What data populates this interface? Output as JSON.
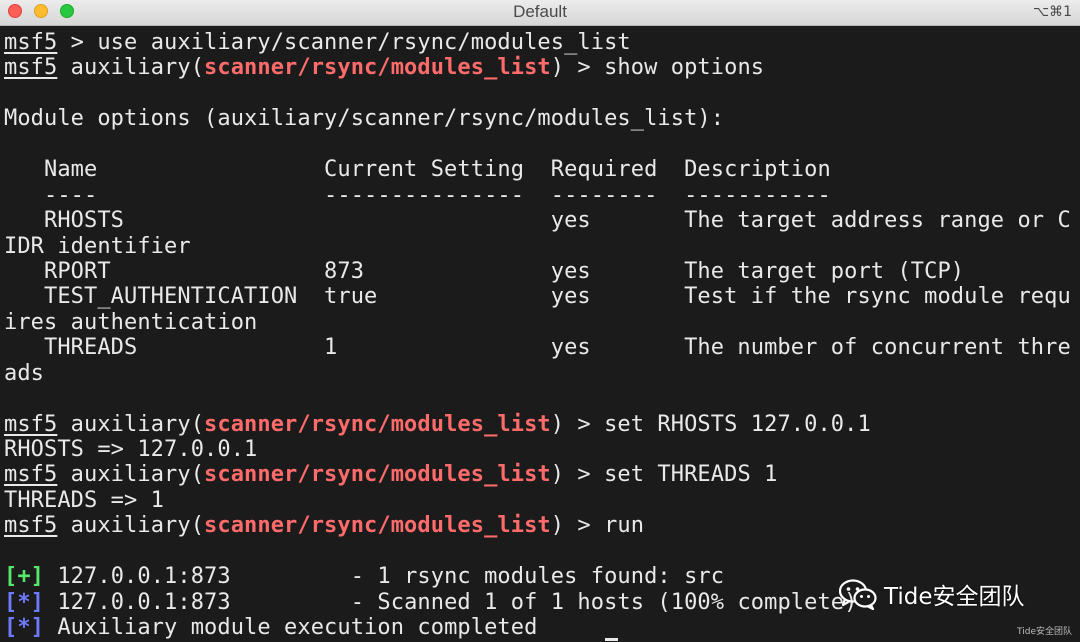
{
  "window": {
    "title": "Default",
    "shortcut": "⌥⌘1"
  },
  "terminal": {
    "lines": [
      {
        "parts": [
          {
            "t": "msf5",
            "cls": "u"
          },
          {
            "t": " > use auxiliary/scanner/rsync/modules_list"
          }
        ]
      },
      {
        "parts": [
          {
            "t": "msf5",
            "cls": "u"
          },
          {
            "t": " auxiliary("
          },
          {
            "t": "scanner/rsync/modules_list",
            "cls": "mod"
          },
          {
            "t": ") > show options"
          }
        ]
      },
      {
        "parts": [
          {
            "t": ""
          }
        ]
      },
      {
        "parts": [
          {
            "t": "Module options (auxiliary/scanner/rsync/modules_list):"
          }
        ]
      },
      {
        "parts": [
          {
            "t": ""
          }
        ]
      },
      {
        "parts": [
          {
            "t": "   Name                 Current Setting  Required  Description"
          }
        ]
      },
      {
        "parts": [
          {
            "t": "   ----                 ---------------  --------  -----------"
          }
        ]
      },
      {
        "parts": [
          {
            "t": "   RHOSTS                                yes       The target address range or C"
          }
        ]
      },
      {
        "parts": [
          {
            "t": "IDR identifier"
          }
        ]
      },
      {
        "parts": [
          {
            "t": "   RPORT                873              yes       The target port (TCP)"
          }
        ]
      },
      {
        "parts": [
          {
            "t": "   TEST_AUTHENTICATION  true             yes       Test if the rsync module requ"
          }
        ]
      },
      {
        "parts": [
          {
            "t": "ires authentication"
          }
        ]
      },
      {
        "parts": [
          {
            "t": "   THREADS              1                yes       The number of concurrent thre"
          }
        ]
      },
      {
        "parts": [
          {
            "t": "ads"
          }
        ]
      },
      {
        "parts": [
          {
            "t": ""
          }
        ]
      },
      {
        "parts": [
          {
            "t": "msf5",
            "cls": "u"
          },
          {
            "t": " auxiliary("
          },
          {
            "t": "scanner/rsync/modules_list",
            "cls": "mod"
          },
          {
            "t": ") > set RHOSTS 127.0.0.1"
          }
        ]
      },
      {
        "parts": [
          {
            "t": "RHOSTS => 127.0.0.1"
          }
        ]
      },
      {
        "parts": [
          {
            "t": "msf5",
            "cls": "u"
          },
          {
            "t": " auxiliary("
          },
          {
            "t": "scanner/rsync/modules_list",
            "cls": "mod"
          },
          {
            "t": ") > set THREADS 1"
          }
        ]
      },
      {
        "parts": [
          {
            "t": "THREADS => 1"
          }
        ]
      },
      {
        "parts": [
          {
            "t": "msf5",
            "cls": "u"
          },
          {
            "t": " auxiliary("
          },
          {
            "t": "scanner/rsync/modules_list",
            "cls": "mod"
          },
          {
            "t": ") > run"
          }
        ]
      },
      {
        "parts": [
          {
            "t": ""
          }
        ]
      },
      {
        "parts": [
          {
            "t": "[+]",
            "cls": "brk"
          },
          {
            "t": " 127.0.0.1:873         - 1 rsync modules found: src"
          }
        ]
      },
      {
        "parts": [
          {
            "t": "[*]",
            "cls": "brk-i"
          },
          {
            "t": " 127.0.0.1:873         - Scanned 1 of 1 hosts (100% complete)"
          }
        ]
      },
      {
        "parts": [
          {
            "t": "[*]",
            "cls": "brk-i"
          },
          {
            "t": " Auxiliary module execution completed"
          }
        ]
      }
    ]
  },
  "watermark": {
    "icon": "wechat-icon",
    "text": "Tide安全团队",
    "small_text": "Tide安全团队"
  }
}
